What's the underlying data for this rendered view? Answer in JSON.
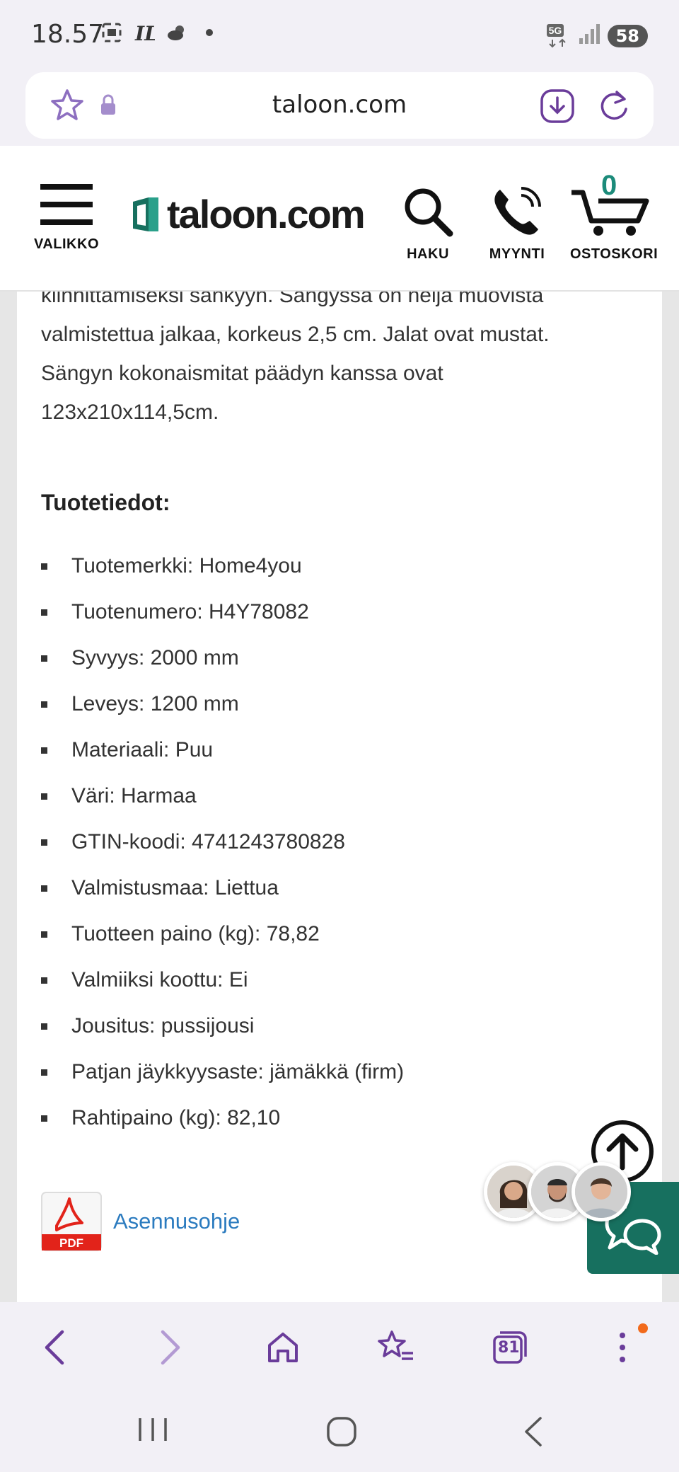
{
  "status_bar": {
    "time": "18.57",
    "network": "5G",
    "battery": "58"
  },
  "url_bar": {
    "url": "taloon.com"
  },
  "header": {
    "logo_text": "taloon.com",
    "menu_label": "VALIKKO",
    "search_label": "HAKU",
    "phone_label": "MYYNTI",
    "cart_label": "OSTOSKORI",
    "cart_count": "0"
  },
  "product": {
    "description": "kiinnittämiseksi sänkyyn. Sängyssä on neljä muovista valmistettua jalkaa, korkeus 2,5 cm. Jalat ovat mustat. Sängyn kokonaismitat päädyn kanssa ovat 123x210x114,5cm.",
    "section_title": "Tuotetiedot:",
    "specs": [
      "Tuotemerkki: Home4you",
      "Tuotenumero: H4Y78082",
      "Syvyys: 2000 mm",
      "Leveys: 1200 mm",
      "Materiaali: Puu",
      "Väri: Harmaa",
      "GTIN-koodi: 4741243780828",
      "Valmistusmaa: Liettua",
      "Tuotteen paino (kg): 78,82",
      "Valmiiksi koottu: Ei",
      "Jousitus: pussijousi",
      "Patjan jäykkyysaste: jämäkkä (firm)",
      "Rahtipaino (kg): 82,10"
    ],
    "pdf_badge": "PDF",
    "pdf_link": "Asennusohje"
  },
  "browser_nav": {
    "tab_count": "81"
  },
  "colors": {
    "brand_teal": "#17705f",
    "link_blue": "#2b7bbf",
    "browser_purple": "#6a3c9a",
    "pdf_red": "#e2231a"
  }
}
